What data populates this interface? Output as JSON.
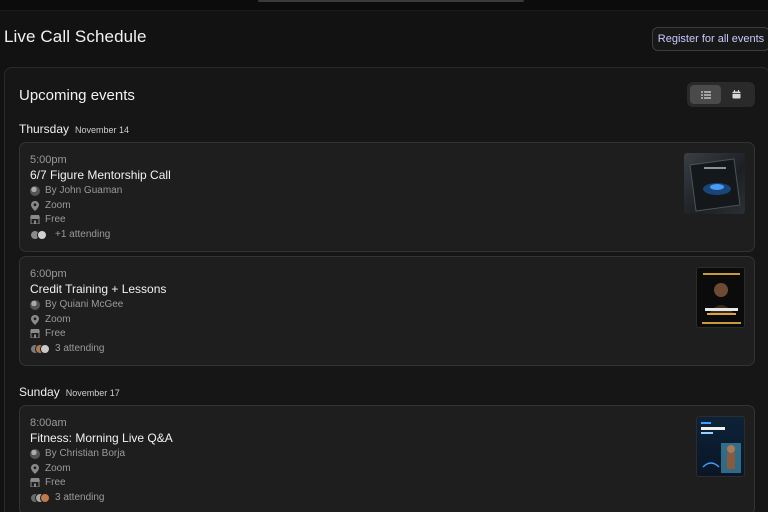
{
  "header": {
    "title": "Live Call Schedule",
    "register_label": "Register for all events"
  },
  "panel": {
    "title": "Upcoming events",
    "view_modes": [
      "list-icon",
      "calendar-icon"
    ],
    "active_view": "list"
  },
  "days": [
    {
      "name": "Thursday",
      "date": "November 14",
      "events": [
        {
          "time": "5:00pm",
          "title": "6/7 Figure Mentorship Call",
          "host": "By John Guaman",
          "location": "Zoom",
          "price": "Free",
          "attending": "+1 attending"
        },
        {
          "time": "6:00pm",
          "title": "Credit Training + Lessons",
          "host": "By Quiani McGee",
          "location": "Zoom",
          "price": "Free",
          "attending": "3 attending"
        }
      ]
    },
    {
      "name": "Sunday",
      "date": "November 17",
      "events": [
        {
          "time": "8:00am",
          "title": "Fitness: Morning Live Q&A",
          "host": "By Christian Borja",
          "location": "Zoom",
          "price": "Free",
          "attending": "3 attending"
        }
      ]
    }
  ],
  "colors": {
    "background": "#121212",
    "card": "#1e1e1e",
    "accent_link": "#c9c9ff",
    "muted_text": "#9a9a9a"
  }
}
